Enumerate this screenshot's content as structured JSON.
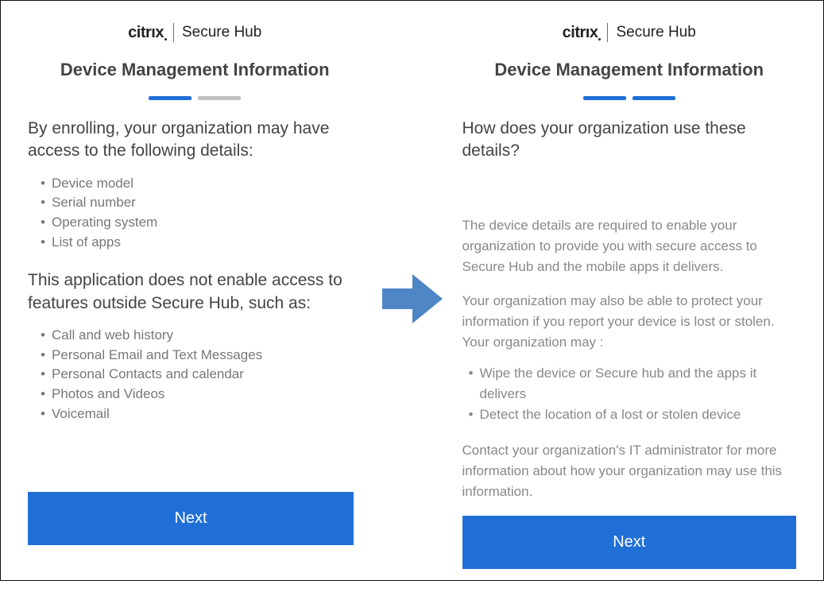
{
  "brand": {
    "vendor": "citrıx",
    "product": "Secure Hub"
  },
  "left": {
    "title": "Device Management Information",
    "progress": {
      "active": 1,
      "total": 2,
      "colors": {
        "active": "#1f6fd6",
        "inactive": "#c1c1c1"
      }
    },
    "heading_a": "By enrolling, your organization may have access to the following details:",
    "list_a": [
      "Device model",
      "Serial number",
      "Operating system",
      "List of apps"
    ],
    "heading_b": "This application does not enable access to features outside Secure Hub, such as:",
    "list_b": [
      "Call and web history",
      "Personal Email and Text Messages",
      "Personal Contacts and calendar",
      "Photos and Videos",
      "Voicemail"
    ],
    "next": "Next"
  },
  "right": {
    "title": "Device Management Information",
    "progress": {
      "active": 2,
      "total": 2
    },
    "heading": "How does your organization use these details?",
    "para1": "The device details are required to enable your organization to provide you with secure access to Secure Hub and the mobile apps it delivers.",
    "para2": "Your organization may also be able to protect your information if you report your device is lost or stolen. Your organization may :",
    "list": [
      "Wipe the device or Secure hub and the apps it delivers",
      "Detect the location of a lost or stolen device"
    ],
    "para3": "Contact your organization's IT administrator for more information about how your organization may use this information.",
    "next": "Next"
  },
  "colors": {
    "accent": "#1f6fd6",
    "arrow": "#4f86c6"
  }
}
